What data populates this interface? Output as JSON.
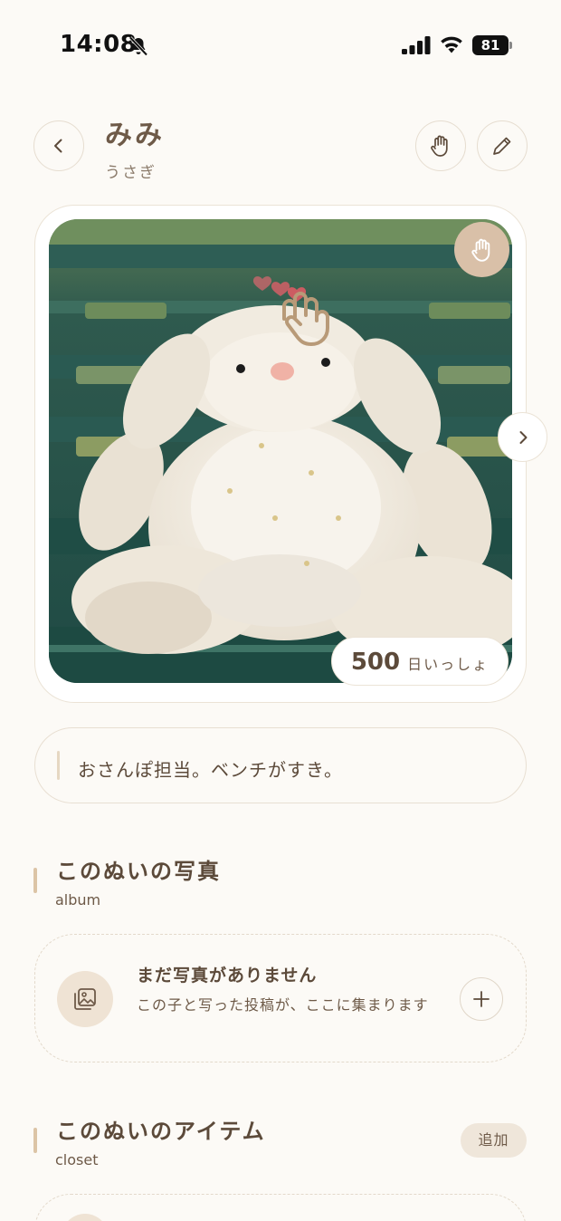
{
  "status_bar": {
    "time": "14:08",
    "battery": "81"
  },
  "header": {
    "name": "みみ",
    "species": "うさぎ"
  },
  "photo_card": {
    "days_count": "500",
    "days_unit": "日いっしょ"
  },
  "description": "おさんぽ担当。ベンチがすき。",
  "album": {
    "title": "このぬいの写真",
    "subtitle": "album",
    "empty_title": "まだ写真がありません",
    "empty_desc": "この子と写った投稿が、ここに集まります"
  },
  "closet": {
    "title": "このぬいのアイテム",
    "subtitle": "closet",
    "add_label": "追加"
  },
  "colors": {
    "background": "#fcfaf6",
    "accent": "#d9c0a8",
    "text": "#5c4a3a",
    "heart": "#e0656a"
  },
  "icons": [
    "bell-muted-icon",
    "signal-icon",
    "wifi-icon",
    "battery-icon",
    "back-chevron-icon",
    "hand-icon",
    "pencil-icon",
    "chevron-right-icon",
    "heart-icon",
    "photo-album-icon",
    "plus-icon"
  ]
}
